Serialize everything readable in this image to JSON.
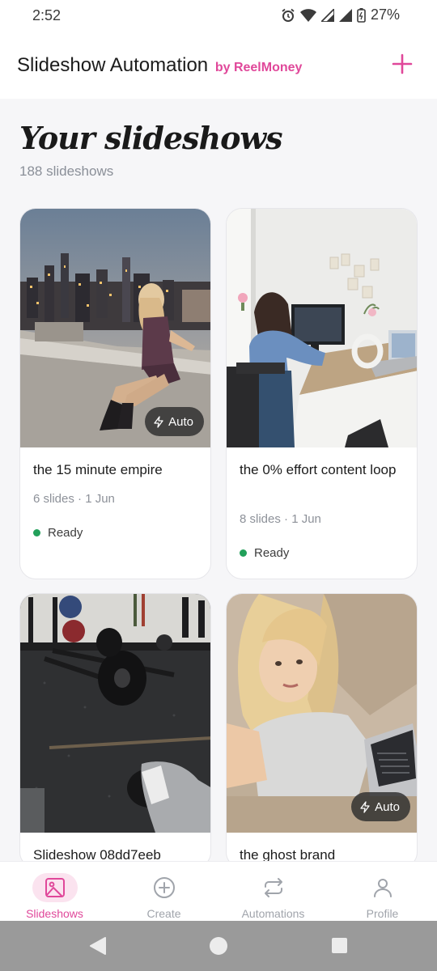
{
  "status_bar": {
    "time": "2:52",
    "battery": "27%"
  },
  "header": {
    "title": "Slideshow Automation",
    "byline": "by ReelMoney",
    "add_icon": "plus-icon"
  },
  "main": {
    "heading": "Your slideshows",
    "count_text": "188 slideshows"
  },
  "cards": [
    {
      "title": "the 15 minute empire",
      "meta": "6 slides · 1 Jun",
      "status": "Ready",
      "badge": "Auto",
      "image": "woman-sitting-on-rooftop-city-skyline"
    },
    {
      "title": "the 0% effort content loop",
      "meta": "8 slides · 1 Jun",
      "status": "Ready",
      "badge": "",
      "image": "woman-working-at-desk-with-computers"
    },
    {
      "title": "Slideshow 08dd7eeb",
      "meta": "",
      "status": "",
      "badge": "",
      "image": "gym-floor-with-barbell-plates"
    },
    {
      "title": "the ghost brand",
      "meta": "",
      "status": "",
      "badge": "Auto",
      "image": "woman-selfie-on-couch-with-laptop"
    }
  ],
  "bottom_nav": [
    {
      "label": "Slideshows",
      "icon": "image-icon",
      "active": true
    },
    {
      "label": "Create",
      "icon": "plus-circle-icon",
      "active": false
    },
    {
      "label": "Automations",
      "icon": "repeat-icon",
      "active": false
    },
    {
      "label": "Profile",
      "icon": "user-icon",
      "active": false
    }
  ],
  "colors": {
    "accent": "#e0489a",
    "ready": "#22a05a",
    "background": "#f6f6f8"
  }
}
